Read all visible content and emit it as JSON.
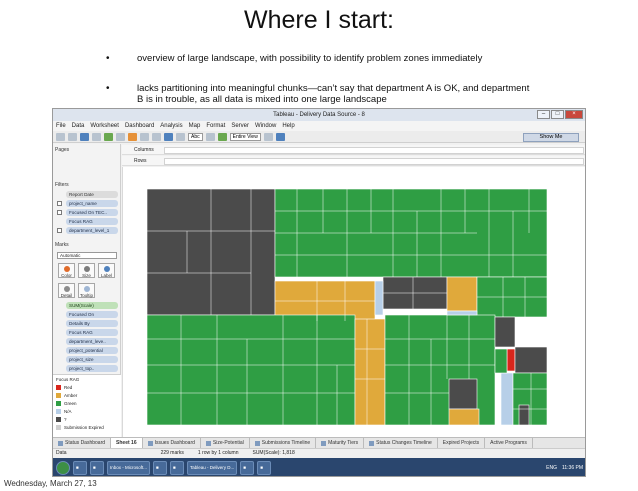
{
  "slide": {
    "title": "Where I start:",
    "bullets": [
      "overview of large landscape, with possibility to identify problem zones immediately",
      "lacks partitioning into meaningful chunks—can’t say that department A is OK, and department B is in trouble, as all data is mixed into one large landscape"
    ],
    "bullet_glyph": "•",
    "footer_date": "Wednesday, March 27, 13"
  },
  "window": {
    "title": "Tableau - Delivery Data Source - 8",
    "menu": [
      "File",
      "Data",
      "Worksheet",
      "Dashboard",
      "Analysis",
      "Map",
      "Format",
      "Server",
      "Window",
      "Help"
    ],
    "toolbar": {
      "font_label": "Abc",
      "view_label": "Entire View",
      "show_me": "Show Me"
    }
  },
  "left_pane": {
    "pages_label": "Pages",
    "filters_label": "Filters",
    "filters": [
      "Report Date",
      "project_name",
      "Focused On TEC..",
      "Focus RAG",
      "department_level_1"
    ],
    "marks_label": "Marks",
    "mark_type": "Automatic",
    "mark_buttons": [
      "Color",
      "Size",
      "Label",
      "Detail",
      "Tooltip"
    ],
    "mark_fields": [
      "SUM(Scale)",
      "Focused On",
      "Details By",
      "Focus RAG",
      "department_leve..",
      "project_potential",
      "project_size",
      "project_top.."
    ],
    "legend_title": "Focus RAG",
    "legend": [
      {
        "label": "Red",
        "color": "#d9261c"
      },
      {
        "label": "Amber",
        "color": "#e0a93b"
      },
      {
        "label": "Green",
        "color": "#2f9e44"
      },
      {
        "label": "N/A",
        "color": "#b7cfe8"
      },
      {
        "label": "?",
        "color": "#4b4b4b"
      },
      {
        "label": "Submission Expired",
        "color": "#cfcfcf"
      }
    ]
  },
  "shelves": {
    "columns_label": "Columns",
    "rows_label": "Rows"
  },
  "sheet_tabs": [
    "Status Dashboard",
    "Sheet 16",
    "Issues Dashboard",
    "Size-Potential",
    "Submissions Timeline",
    "Maturity Tiers",
    "Status Changes Timeline",
    "Expired Projects",
    "Active Programs"
  ],
  "active_tab": "Sheet 16",
  "status_bar": {
    "source": "Data",
    "marks": "229 marks",
    "dims": "1 row by 1 column",
    "sum": "SUM(Scale): 1,818"
  },
  "taskbar": {
    "items": [
      "Inbox - Microsoft...",
      "Tableau - Delivery D..."
    ],
    "lang": "ENG",
    "clock": "11:36 PM"
  },
  "palette": {
    "green": "#2f9e44",
    "dark": "#4b4b4b",
    "amber": "#e0a93b",
    "red": "#d9261c",
    "na": "#b7cfe8"
  }
}
